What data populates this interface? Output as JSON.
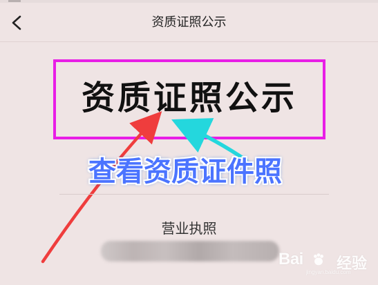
{
  "header": {
    "title": "资质证照公示"
  },
  "icons": {
    "back": "chevron-left-icon",
    "watermark_paw": "baidu-paw-icon"
  },
  "main": {
    "big_title": "资质证照公示",
    "annotation_caption": "查看资质证件照",
    "section_title": "营业执照"
  },
  "watermark": {
    "brand": "Bai",
    "suffix": "经验",
    "url": "jingyan.baidu.com"
  },
  "colors": {
    "background": "#efe4e4",
    "highlight_border": "#e81ee6",
    "caption_fill": "#4b74ff",
    "red_arrow": "#ef3d3d",
    "cyan_arrow": "#24d7dd"
  }
}
